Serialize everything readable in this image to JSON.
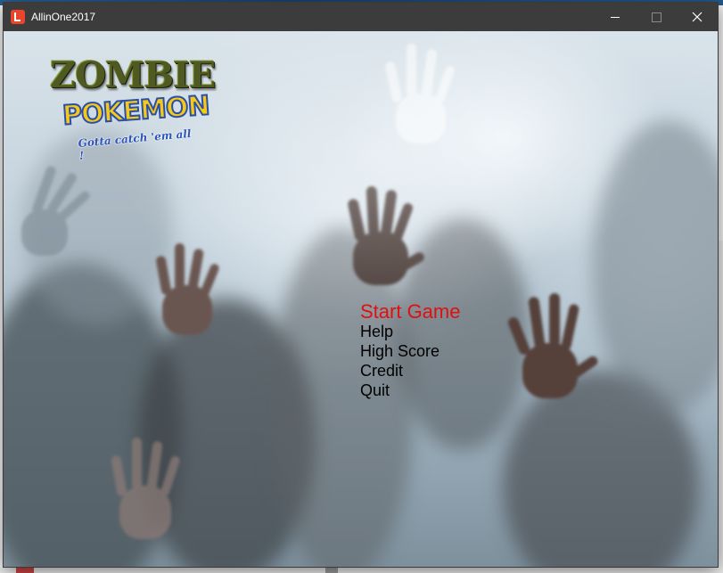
{
  "window": {
    "title": "AllinOne2017"
  },
  "logo": {
    "title": "ZOMBIE",
    "brand": "POKEMON",
    "tagline": "Gotta catch 'em all !"
  },
  "menu": {
    "items": [
      {
        "label": "Start Game",
        "selected": true
      },
      {
        "label": "Help",
        "selected": false
      },
      {
        "label": "High Score",
        "selected": false
      },
      {
        "label": "Credit",
        "selected": false
      },
      {
        "label": "Quit",
        "selected": false
      }
    ],
    "selected_color": "#e01010",
    "default_color": "#000000"
  },
  "icons": {
    "app": "monogame-app-icon",
    "minimize": "minimize-icon",
    "maximize": "maximize-icon",
    "close": "close-icon"
  }
}
